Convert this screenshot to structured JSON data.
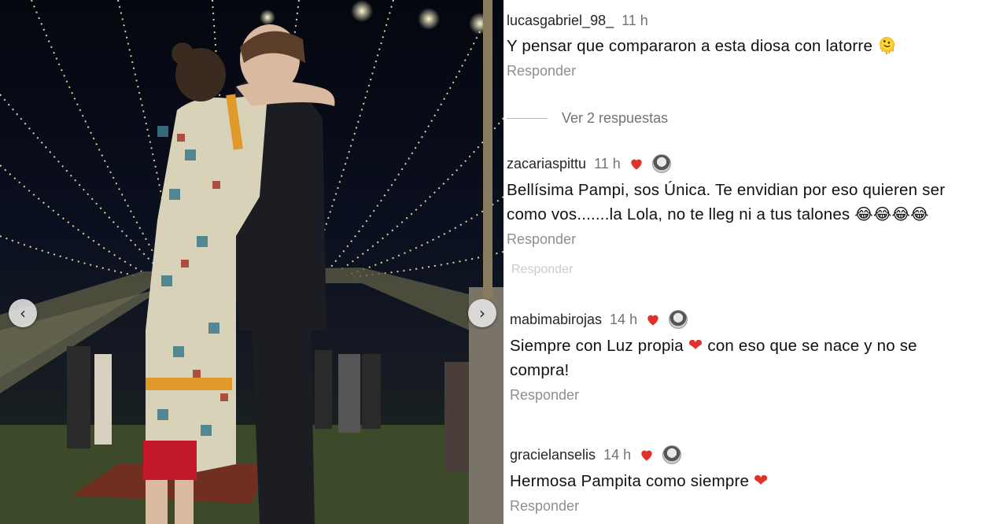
{
  "comments": [
    {
      "user": "lucasgabriel_98_",
      "time": "11 h",
      "text": "Y pensar que compararon a esta diosa con latorre",
      "emoji": "🫠",
      "reply_label": "Responder",
      "liked_by_author": false
    },
    {
      "user": "zacariaspittu",
      "time": "11 h",
      "text_line1": "Bellísima  Pampi,  sos Única.  Te envidian  por eso quieren ser",
      "text_line2": "como vos.......la Lola,  no te lleg ni a tus talones",
      "emoji": "😂😂😂😂",
      "reply_label": "Responder",
      "liked_by_author": true
    },
    {
      "user": "mabimabirojas",
      "time": "14 h",
      "text_part1": "Siempre con Luz propia",
      "heart": "❤",
      "text_part2": " con eso que se nace y no se",
      "text_line2": "compra!",
      "reply_label": "Responder",
      "liked_by_author": true
    },
    {
      "user": "gracielanselis",
      "time": "14 h",
      "text": "Hermosa Pampita como siempre",
      "heart": "❤",
      "reply_label": "Responder",
      "liked_by_author": true
    }
  ],
  "view_replies_label": "Ver 2 respuestas",
  "ghost_text": "Responder",
  "photo": {
    "prev_icon": "‹",
    "next_icon": "›"
  },
  "colors": {
    "heart": "#e0322b",
    "username": "#262626",
    "meta_gray": "#737373",
    "reply_gray": "#8e8e8e"
  }
}
